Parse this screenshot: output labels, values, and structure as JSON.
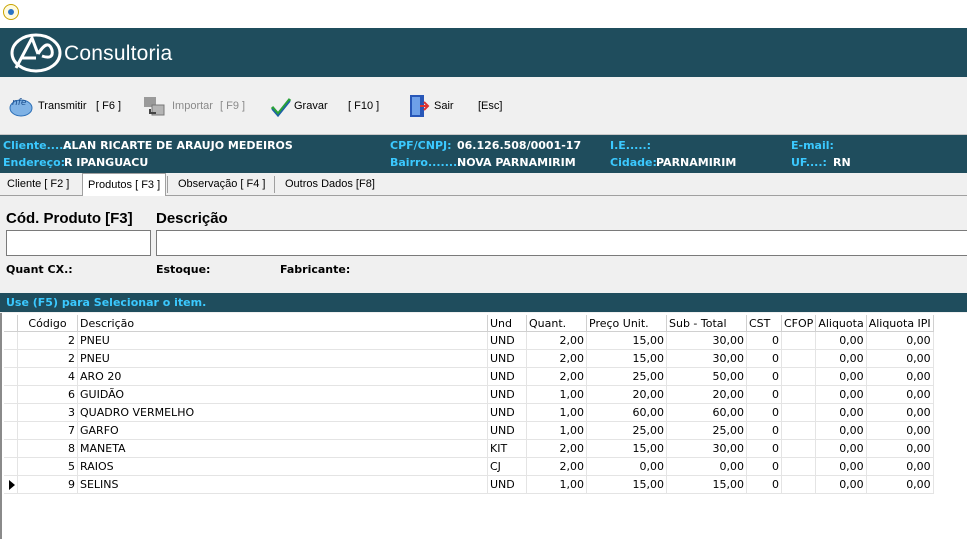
{
  "app": {
    "brand": "Consultoria"
  },
  "toolbar": [
    {
      "label": "Transmitir",
      "key": "[ F6 ]",
      "icon": "nfe-transmit-icon",
      "enabled": true
    },
    {
      "label": "Importar",
      "key": "[ F9 ]",
      "icon": "import-icon",
      "enabled": false
    },
    {
      "label": "Gravar",
      "key": "[ F10 ]",
      "icon": "checkmark-icon",
      "enabled": true
    },
    {
      "label": "Sair",
      "key": "[Esc]",
      "icon": "exit-door-icon",
      "enabled": true
    }
  ],
  "client": {
    "cliente_label": "Cliente.....:",
    "cliente": "ALAN RICARTE DE ARAUJO MEDEIROS",
    "endereco_label": "Endereço:",
    "endereco": "R IPANGUACU",
    "cpf_label": "CPF/CNPJ:",
    "cpf": "06.126.508/0001-17",
    "bairro_label": "Bairro.......:",
    "bairro": "NOVA PARNAMIRIM",
    "ie_label": "I.E.....:",
    "ie": "",
    "cidade_label": "Cidade:",
    "cidade": "PARNAMIRIM",
    "email_label": "E-mail:",
    "email": "",
    "uf_label": "UF....:",
    "uf": "RN"
  },
  "tabs": [
    "Cliente [ F2 ]",
    "Produtos [ F3 ]",
    "Observação [ F4 ]",
    "Outros Dados [F8]"
  ],
  "active_tab": 1,
  "product_form": {
    "code_label": "Cód. Produto [F3]",
    "desc_label": "Descrição",
    "code_value": "",
    "desc_value": "",
    "quant_cx_label": "Quant CX.:",
    "estoque_label": "Estoque:",
    "fabricante_label": "Fabricante:"
  },
  "hint": "Use (F5) para Selecionar o item.",
  "grid": {
    "columns": [
      "Código",
      "Descrição",
      "Und",
      "Quant.",
      "Preço Unit.",
      "Sub - Total",
      "CST",
      "CFOP",
      "Aliquota",
      "Aliquota IPI"
    ],
    "selected_row": 8,
    "rows": [
      [
        "2",
        "PNEU",
        "UND",
        "2,00",
        "15,00",
        "30,00",
        "0",
        "",
        "0,00",
        "0,00"
      ],
      [
        "2",
        "PNEU",
        "UND",
        "2,00",
        "15,00",
        "30,00",
        "0",
        "",
        "0,00",
        "0,00"
      ],
      [
        "4",
        "ARO 20",
        "UND",
        "2,00",
        "25,00",
        "50,00",
        "0",
        "",
        "0,00",
        "0,00"
      ],
      [
        "6",
        "GUIDÃO",
        "UND",
        "1,00",
        "20,00",
        "20,00",
        "0",
        "",
        "0,00",
        "0,00"
      ],
      [
        "3",
        "QUADRO VERMELHO",
        "UND",
        "1,00",
        "60,00",
        "60,00",
        "0",
        "",
        "0,00",
        "0,00"
      ],
      [
        "7",
        "GARFO",
        "UND",
        "1,00",
        "25,00",
        "25,00",
        "0",
        "",
        "0,00",
        "0,00"
      ],
      [
        "8",
        "MANETA",
        "KIT",
        "2,00",
        "15,00",
        "30,00",
        "0",
        "",
        "0,00",
        "0,00"
      ],
      [
        "5",
        "RAIOS",
        "CJ",
        "2,00",
        "0,00",
        "0,00",
        "0",
        "",
        "0,00",
        "0,00"
      ],
      [
        "9",
        "SELINS",
        "UND",
        "1,00",
        "15,00",
        "15,00",
        "0",
        "",
        "0,00",
        "0,00"
      ]
    ]
  }
}
